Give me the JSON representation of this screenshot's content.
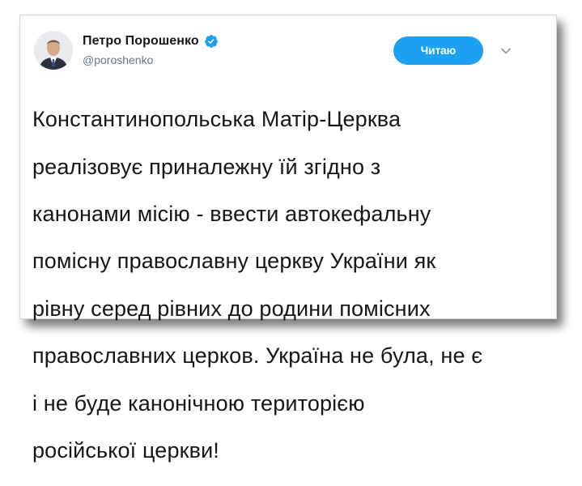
{
  "tweet": {
    "author_name": "Петро Порошенко",
    "author_handle": "@poroshenko",
    "verified": true,
    "follow_button_label": "Читаю",
    "text_lines": [
      "Константинопольська Матір-Церква",
      "реалізовує приналежну їй згідно з",
      "канонами місію - ввести автокефальну",
      "помісну православну церкву України як",
      "рівну серед рівних до родини помісних",
      "православних церков. Україна не була, не є",
      "і не буде канонічною територією",
      "російської церкви!"
    ]
  },
  "icons": {
    "verified": "verified-badge-icon",
    "menu": "chevron-down-icon",
    "avatar": "profile-photo"
  },
  "colors": {
    "accent": "#1da1f2",
    "name": "#14171a",
    "handle": "#657786"
  }
}
